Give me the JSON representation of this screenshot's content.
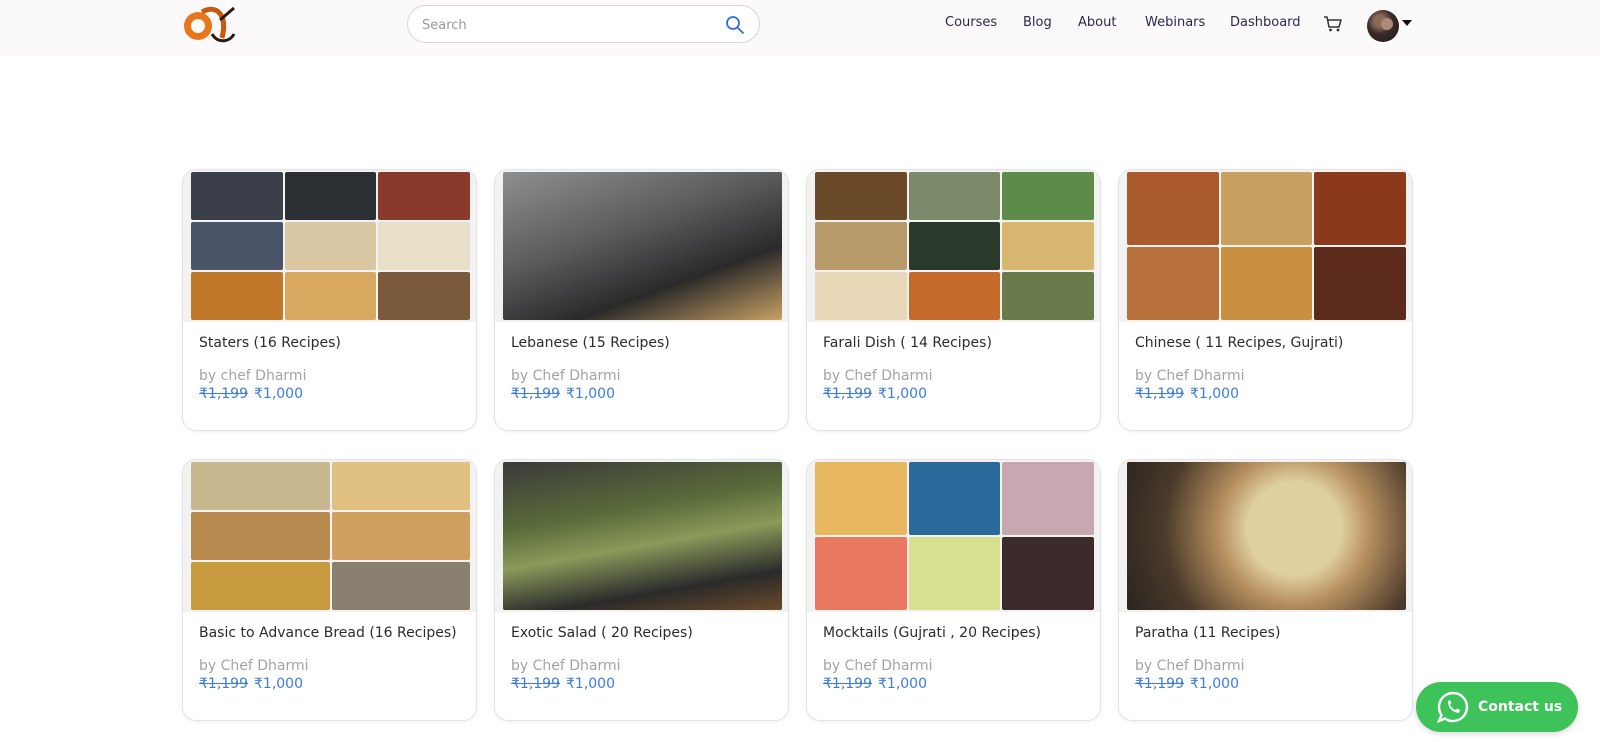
{
  "header": {
    "search_placeholder": "Search",
    "nav": [
      "Courses",
      "Blog",
      "About",
      "Webinars",
      "Dashboard"
    ]
  },
  "courses": [
    {
      "title": "Staters (16 Recipes)",
      "author": "by chef Dharmi",
      "old_price": "₹1,199",
      "price": "₹1,000"
    },
    {
      "title": "Lebanese (15 Recipes)",
      "author": "by Chef Dharmi",
      "old_price": "₹1,199",
      "price": "₹1,000"
    },
    {
      "title": "Farali Dish ( 14 Recipes)",
      "author": "by Chef Dharmi",
      "old_price": "₹1,199",
      "price": "₹1,000"
    },
    {
      "title": "Chinese ( 11 Recipes, Gujrati)",
      "author": "by Chef Dharmi",
      "old_price": "₹1,199",
      "price": "₹1,000"
    },
    {
      "title": "Basic to Advance Bread (16 Recipes)",
      "author": "by Chef Dharmi",
      "old_price": "₹1,199",
      "price": "₹1,000"
    },
    {
      "title": "Exotic Salad ( 20 Recipes)",
      "author": "by Chef Dharmi",
      "old_price": "₹1,199",
      "price": "₹1,000"
    },
    {
      "title": "Mocktails (Gujrati , 20 Recipes)",
      "author": "by Chef Dharmi",
      "old_price": "₹1,199",
      "price": "₹1,000"
    },
    {
      "title": "Paratha (11 Recipes)",
      "author": "by Chef Dharmi",
      "old_price": "₹1,199",
      "price": "₹1,000"
    }
  ],
  "contact": {
    "label": "Contact us"
  },
  "colors": {
    "accent": "#3d7be0",
    "whatsapp": "#3ec35a",
    "logo": "#e8761c"
  }
}
